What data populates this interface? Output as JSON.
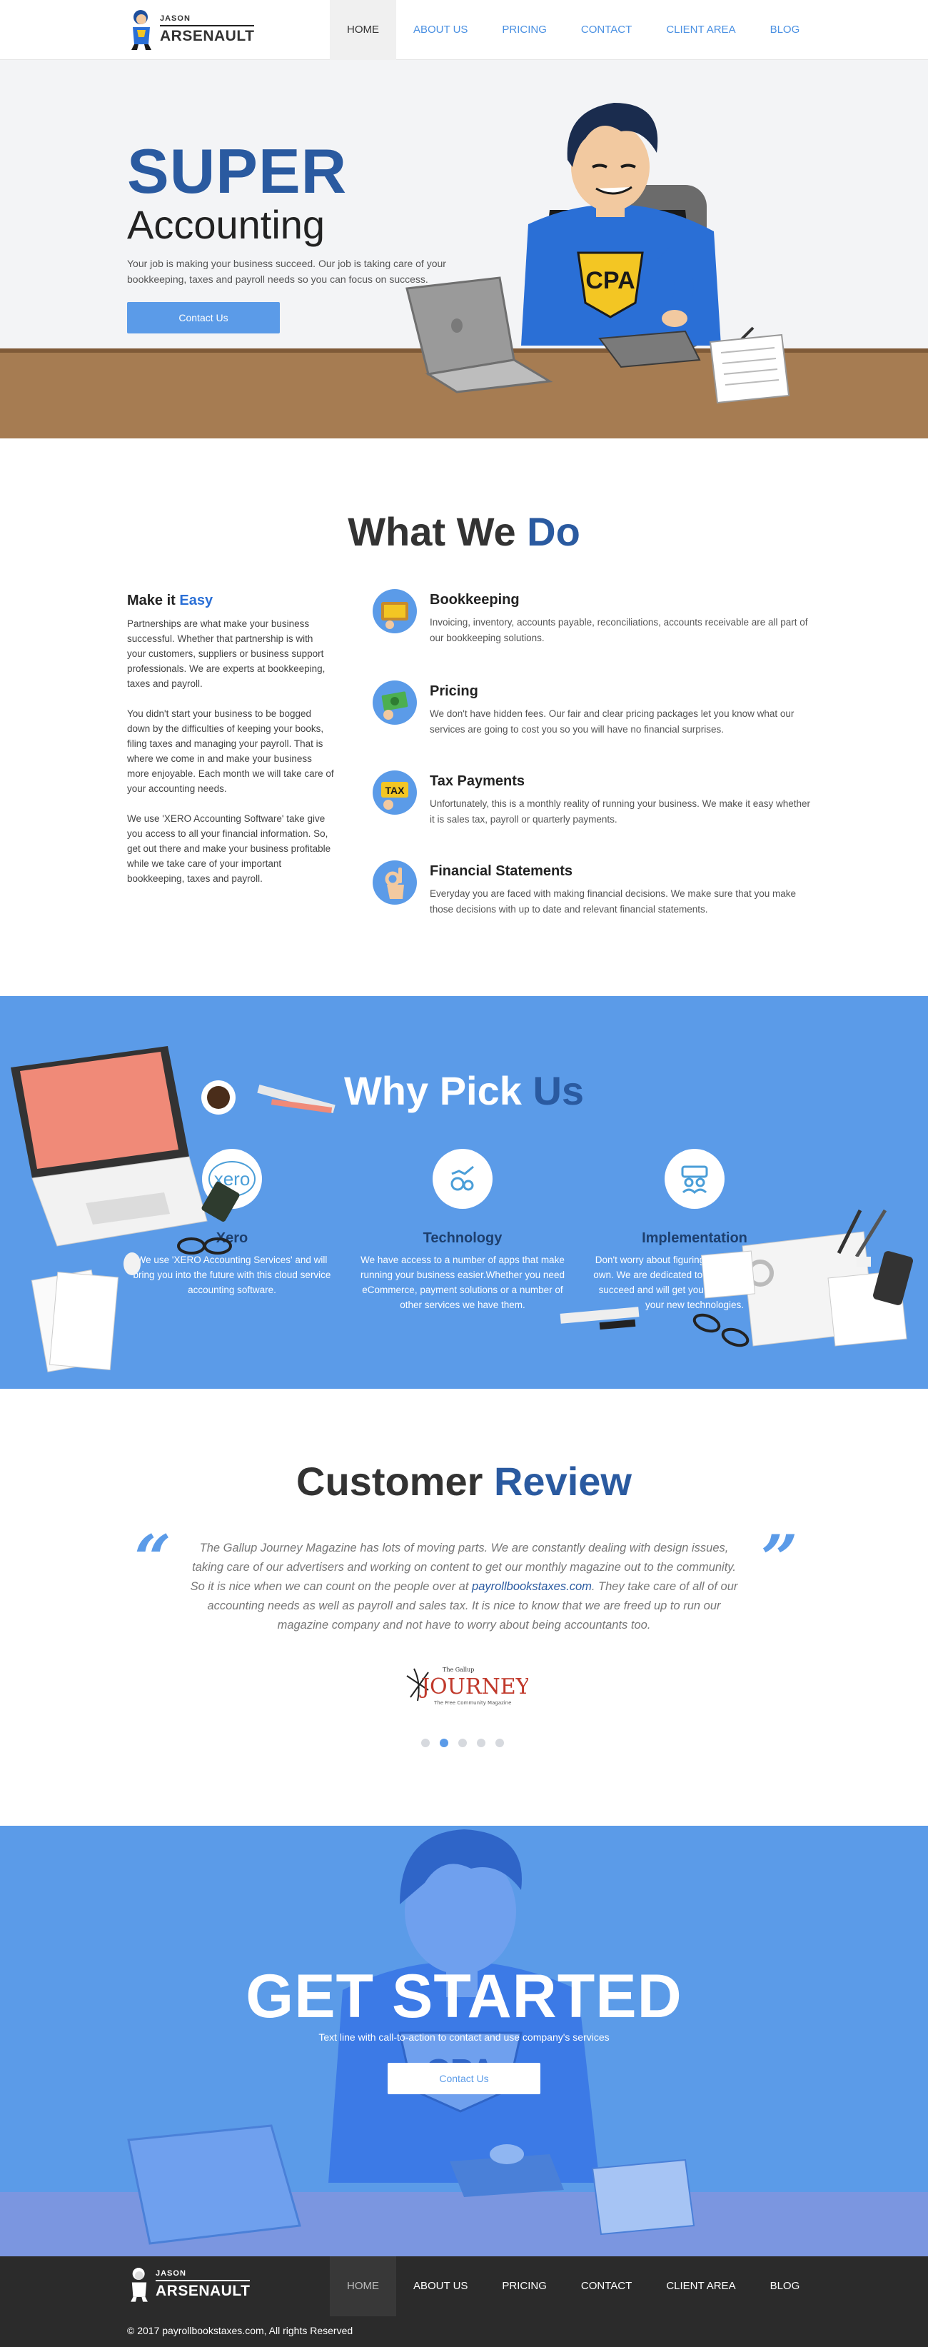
{
  "brand": {
    "line1": "JASON",
    "line2": "ARSENAULT"
  },
  "nav": [
    {
      "label": "HOME",
      "active": true
    },
    {
      "label": "ABOUT US"
    },
    {
      "label": "PRICING"
    },
    {
      "label": "CONTACT"
    },
    {
      "label": "CLIENT AREA"
    },
    {
      "label": "BLOG"
    }
  ],
  "hero": {
    "title": "SUPER",
    "subtitle": "Accounting",
    "text": "Your job is making your business succeed. Our job is taking care of your bookkeeping, taxes and payroll needs so you can focus on success.",
    "button": "Contact Us",
    "badge": "CPA"
  },
  "what_we_do": {
    "title_a": "What We ",
    "title_b": "Do",
    "left": {
      "heading_a": "Make it ",
      "heading_b": "Easy",
      "p1": "Partnerships are what make your business successful. Whether that partnership is with your customers, suppliers or business support professionals. We are experts at bookkeeping, taxes and payroll.",
      "p2": "You didn't start your business to be bogged down by the difficulties of keeping your books, filing taxes and managing your payroll. That is where we come in and make your business more enjoyable. Each month we will take care of your accounting needs.",
      "p3": "We use 'XERO Accounting Software' take give you access to all your financial information. So, get out there and make your business profitable while we take care of your important bookkeeping, taxes and payroll."
    },
    "services": [
      {
        "title": "Bookkeeping",
        "text": "Invoicing, inventory, accounts payable, reconciliations, accounts receivable are all part of our bookkeeping solutions.",
        "icon": "ledger-icon"
      },
      {
        "title": "Pricing",
        "text": "We don't have hidden fees. Our fair and clear pricing packages let you know what our services are going to cost you so you will have no financial surprises.",
        "icon": "money-icon"
      },
      {
        "title": "Tax Payments",
        "text": "Unfortunately, this is a monthly reality of running your business. We make it easy whether it is sales tax, payroll or quarterly payments.",
        "icon": "tax-icon",
        "icon_text": "TAX"
      },
      {
        "title": "Financial Statements",
        "text": "Everyday you are faced with making financial decisions. We make sure that you make those decisions with up to date and relevant financial statements.",
        "icon": "ok-hand-icon"
      }
    ]
  },
  "why": {
    "title_a": "Why Pick ",
    "title_b": "Us",
    "cols": [
      {
        "title": "Xero",
        "text": "We use 'XERO Accounting Services' and will bring you into the future with this cloud service accounting software.",
        "icon": "xero-icon",
        "icon_text": "xero"
      },
      {
        "title": "Technology",
        "text": "We have access to a number of apps that make running your business easier.Whether you need eCommerce, payment solutions or a number of other services we have them.",
        "icon": "gears-chart-icon"
      },
      {
        "title": "Implementation",
        "text": "Don't worry about figuring this stuff out on your own. We are dedicated to seeing your business succeed and will get you up and running with your new technologies.",
        "icon": "team-icon"
      }
    ]
  },
  "review": {
    "title_a": "Customer ",
    "title_b": "Review",
    "quote_a": "The Gallup Journey Magazine has lots of moving parts. We are constantly dealing with design issues, taking care of our advertisers and working on content to get our monthly magazine out to the community. So it is nice when we can count on the people over at ",
    "quote_link": "payrollbookstaxes.com",
    "quote_b": ". They take care of all of our accounting needs as well as payroll and sales tax. It is nice to know that we are freed up to run our magazine company and not have to worry about being accountants too.",
    "open_mark": "“",
    "close_mark": "”",
    "logo_text": "JOURNEY",
    "logo_small": "The Gallup",
    "logo_tag": "The Free Community Magazine",
    "dots": 5,
    "active_dot": 1
  },
  "cta": {
    "title": "GET STARTED",
    "text": "Text line with call-to-action to contact and use company's services",
    "button": "Contact Us",
    "badge": "CPA"
  },
  "footer": {
    "nav": [
      {
        "label": "HOME",
        "active": true
      },
      {
        "label": "ABOUT US"
      },
      {
        "label": "PRICING"
      },
      {
        "label": "CONTACT"
      },
      {
        "label": "CLIENT AREA"
      },
      {
        "label": "BLOG"
      }
    ],
    "copyright": "© 2017 payrollbookstaxes.com, All rights Reserved"
  },
  "colors": {
    "accent": "#5b9be8",
    "brand_dark": "#2a5aa0",
    "footer": "#2b2b2b",
    "desk": "#a67c52"
  }
}
